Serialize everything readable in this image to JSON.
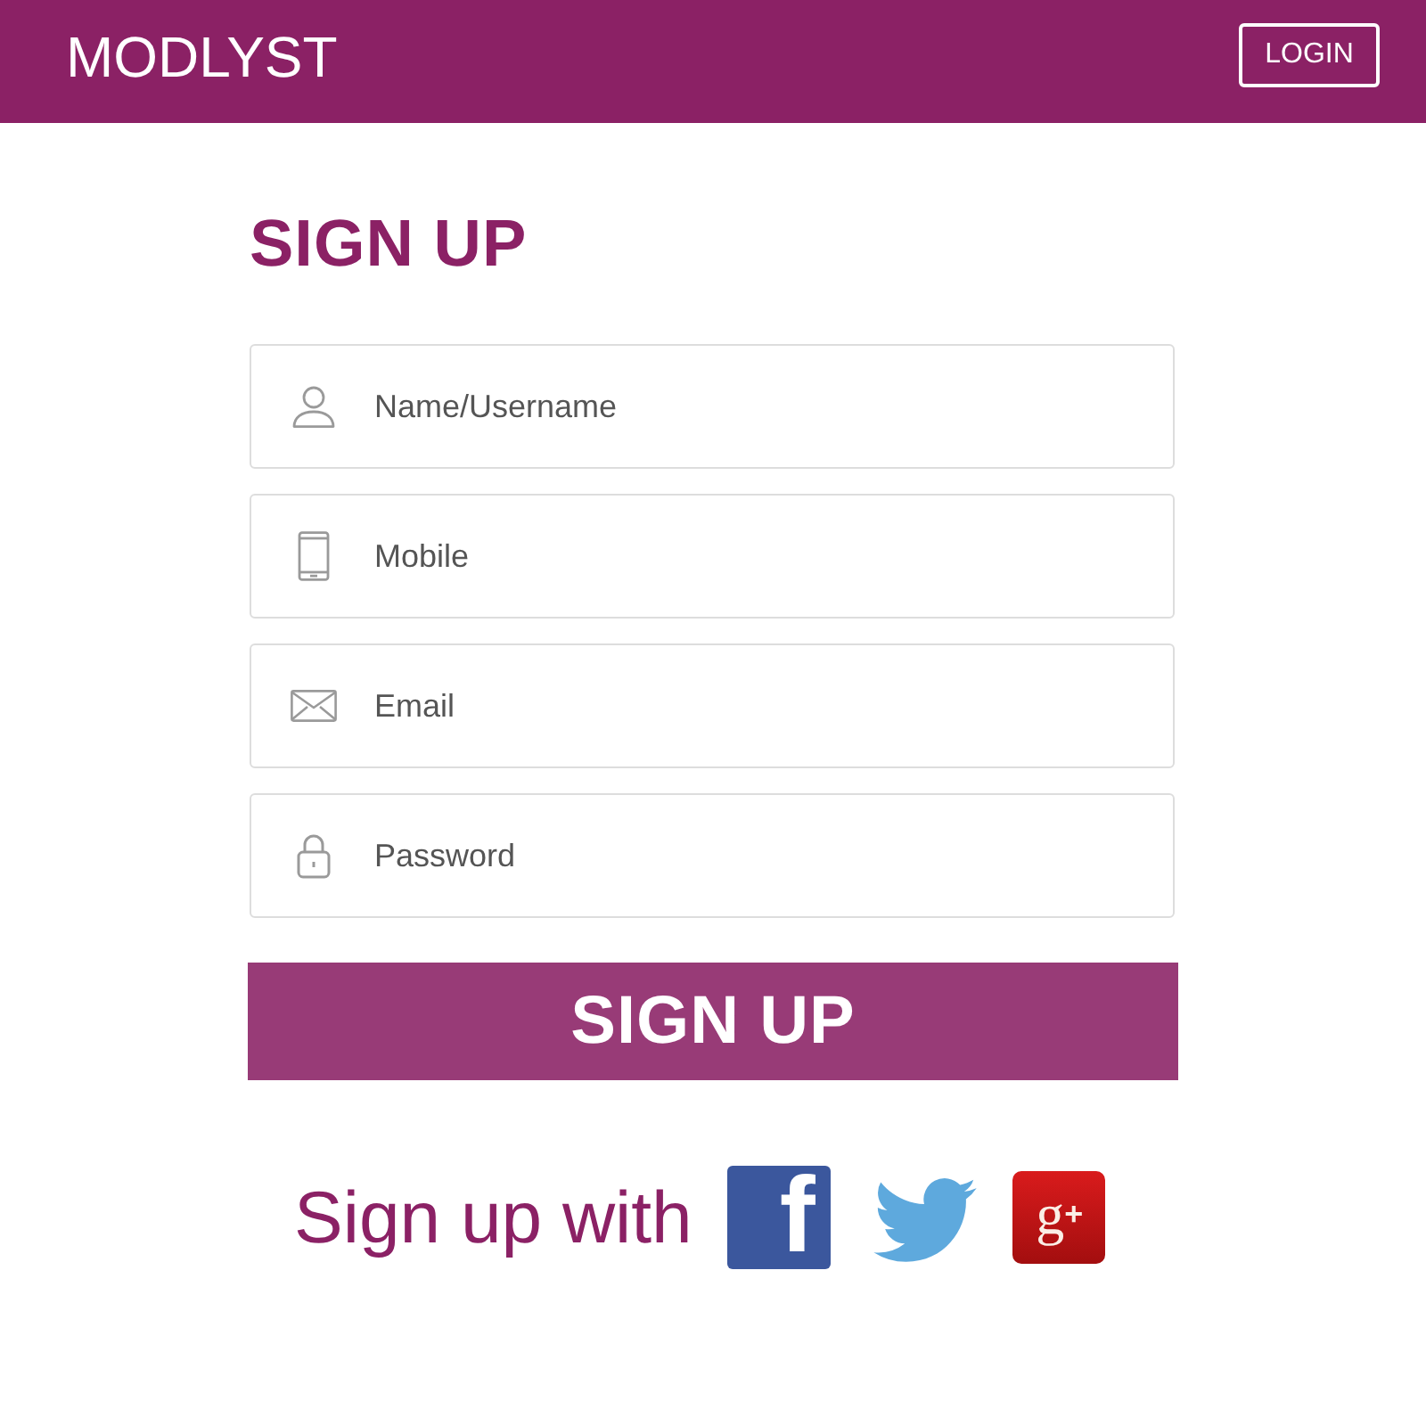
{
  "header": {
    "logo": "MODLYST",
    "login_button": "LOGIN"
  },
  "form": {
    "title": "SIGN UP",
    "fields": [
      {
        "kind": "user",
        "placeholder": "Name/Username"
      },
      {
        "kind": "mobile",
        "placeholder": "Mobile"
      },
      {
        "kind": "email",
        "placeholder": "Email"
      },
      {
        "kind": "password",
        "placeholder": "Password"
      }
    ],
    "submit_button": "SIGN UP"
  },
  "social": {
    "label": "Sign up with",
    "buttons": [
      {
        "kind": "facebook",
        "glyph": "f"
      },
      {
        "kind": "twitter"
      },
      {
        "kind": "google_plus",
        "glyph": "g$^{+}$"
      }
    ]
  }
}
